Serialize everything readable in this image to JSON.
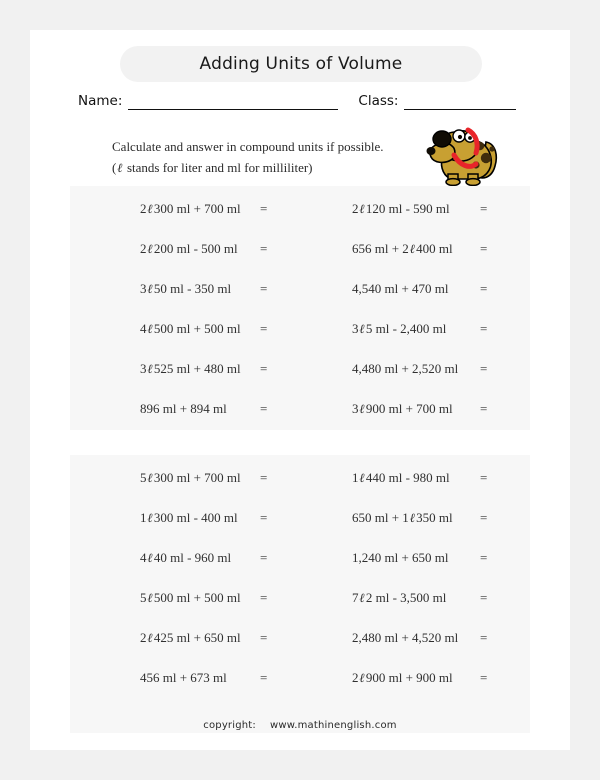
{
  "worksheet": {
    "title": "Adding Units of Volume",
    "name_label": "Name:",
    "class_label": "Class:",
    "instruction_line_1": "Calculate and answer in compound units if  possible.",
    "instruction_line_2_prefix": "(",
    "instruction_line_2": " stands for liter and ml for milliliter)",
    "liter_symbol": "ℓ",
    "equals": "=",
    "clipart": "cartoon-dog",
    "colors": {
      "page_background": "#f1f1f1",
      "sheet": "#ffffff",
      "panel": "#f7f7f7",
      "title_pill": "#f2f2f2",
      "text": "#303030",
      "dog_body": "#c8a032",
      "dog_spots": "#4a3410",
      "dog_collar": "#e8252a"
    }
  },
  "footer": {
    "copyright_label": "copyright:",
    "url": "www.mathinenglish.com"
  },
  "blocks": [
    {
      "id": "block-1",
      "rows": [
        {
          "left": {
            "a": "2",
            "unit": "ℓ",
            "b": " 300 ml + 700 ml"
          },
          "right": {
            "a": "2",
            "unit": "ℓ",
            "b": " 120 ml - 590 ml"
          }
        },
        {
          "left": {
            "a": "2",
            "unit": "ℓ",
            "b": " 200 ml - 500 ml"
          },
          "right": {
            "a": "656 ml + 2",
            "unit": "ℓ",
            "b": " 400 ml"
          }
        },
        {
          "left": {
            "a": "3",
            "unit": "ℓ",
            "b": " 50 ml - 350 ml"
          },
          "right": {
            "a": "4,540 ml + 470 ml",
            "unit": "",
            "b": ""
          }
        },
        {
          "left": {
            "a": "4",
            "unit": "ℓ",
            "b": " 500 ml + 500 ml"
          },
          "right": {
            "a": "3",
            "unit": "ℓ",
            "b": " 5 ml - 2,400 ml"
          }
        },
        {
          "left": {
            "a": "3",
            "unit": "ℓ",
            "b": " 525 ml + 480 ml"
          },
          "right": {
            "a": "4,480 ml + 2,520 ml",
            "unit": "",
            "b": ""
          }
        },
        {
          "left": {
            "a": "896 ml + 894 ml",
            "unit": "",
            "b": ""
          },
          "right": {
            "a": "3",
            "unit": "ℓ",
            "b": " 900 ml + 700 ml"
          }
        }
      ]
    },
    {
      "id": "block-2",
      "rows": [
        {
          "left": {
            "a": "5",
            "unit": "ℓ",
            "b": " 300 ml + 700 ml"
          },
          "right": {
            "a": "1",
            "unit": "ℓ",
            "b": " 440 ml - 980 ml"
          }
        },
        {
          "left": {
            "a": "1",
            "unit": "ℓ",
            "b": " 300 ml - 400 ml"
          },
          "right": {
            "a": "650 ml + 1",
            "unit": "ℓ",
            "b": " 350 ml"
          }
        },
        {
          "left": {
            "a": "4",
            "unit": "ℓ",
            "b": " 40 ml - 960 ml"
          },
          "right": {
            "a": "1,240 ml + 650 ml",
            "unit": "",
            "b": ""
          }
        },
        {
          "left": {
            "a": "5",
            "unit": "ℓ",
            "b": " 500 ml + 500 ml"
          },
          "right": {
            "a": "7",
            "unit": "ℓ",
            "b": " 2 ml - 3,500 ml"
          }
        },
        {
          "left": {
            "a": "2",
            "unit": "ℓ",
            "b": " 425 ml + 650 ml"
          },
          "right": {
            "a": "2,480 ml + 4,520 ml",
            "unit": "",
            "b": ""
          }
        },
        {
          "left": {
            "a": "456 ml + 673 ml",
            "unit": "",
            "b": ""
          },
          "right": {
            "a": "2",
            "unit": "ℓ",
            "b": " 900 ml + 900 ml"
          }
        }
      ]
    }
  ]
}
